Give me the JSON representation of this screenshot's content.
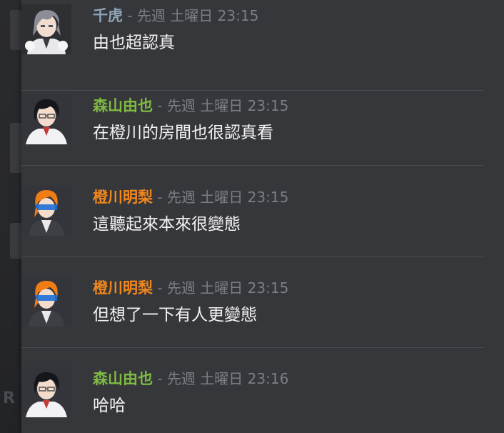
{
  "timestamp_separator": " - ",
  "colors": {
    "name_gray": "#8ea5b8",
    "name_green": "#7fba43",
    "name_orange": "#f2871c"
  },
  "messages": [
    {
      "author": "千虎",
      "author_color": "#8ea5b8",
      "time": "先週 土曜日 23:15",
      "text": "由也超認真",
      "avatar": "gray-hair-avatar"
    },
    {
      "author": "森山由也",
      "author_color": "#7fba43",
      "time": "先週 土曜日 23:15",
      "text": "在橙川的房間也很認真看",
      "avatar": "black-hair-avatar"
    },
    {
      "author": "橙川明梨",
      "author_color": "#f2871c",
      "time": "先週 土曜日 23:15",
      "text": "這聽起來本來很變態",
      "avatar": "orange-hair-avatar"
    },
    {
      "author": "橙川明梨",
      "author_color": "#f2871c",
      "time": "先週 土曜日 23:15",
      "text": "但想了一下有人更變態",
      "avatar": "orange-hair-avatar"
    },
    {
      "author": "森山由也",
      "author_color": "#7fba43",
      "time": "先週 土曜日 23:16",
      "text": "哈哈",
      "avatar": "black-hair-avatar"
    }
  ]
}
